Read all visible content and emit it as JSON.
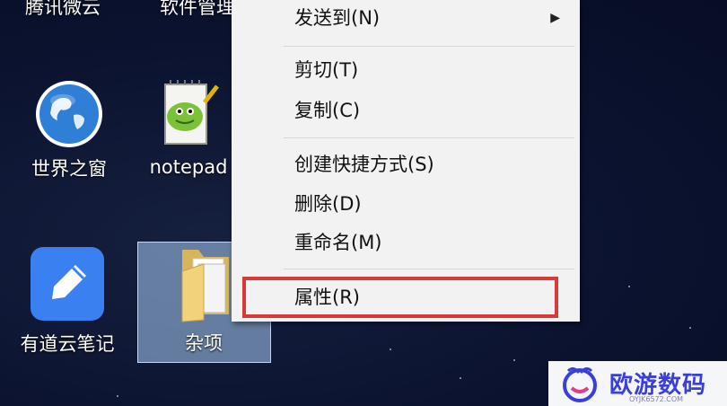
{
  "desktop": {
    "top_labels": [
      "腾讯微云",
      "软件管理"
    ],
    "icons": [
      {
        "label": "世界之窗",
        "icon": "globe-icon"
      },
      {
        "label": "notepad",
        "icon": "notepad-icon"
      },
      {
        "label": "有道云笔记",
        "icon": "pen-note-icon"
      },
      {
        "label": "杂项",
        "icon": "folder-icon",
        "selected": true
      }
    ]
  },
  "context_menu": {
    "items": [
      {
        "label": "发送到(N)",
        "submenu": true
      },
      {
        "label": "剪切(T)"
      },
      {
        "label": "复制(C)"
      },
      {
        "label": "创建快捷方式(S)"
      },
      {
        "label": "删除(D)"
      },
      {
        "label": "重命名(M)"
      },
      {
        "label": "属性(R)",
        "highlighted": true
      }
    ],
    "highlight_color": "#d83a3a"
  },
  "watermark": {
    "title": "欧游数码",
    "subtitle": "OYJK6572.COM"
  }
}
